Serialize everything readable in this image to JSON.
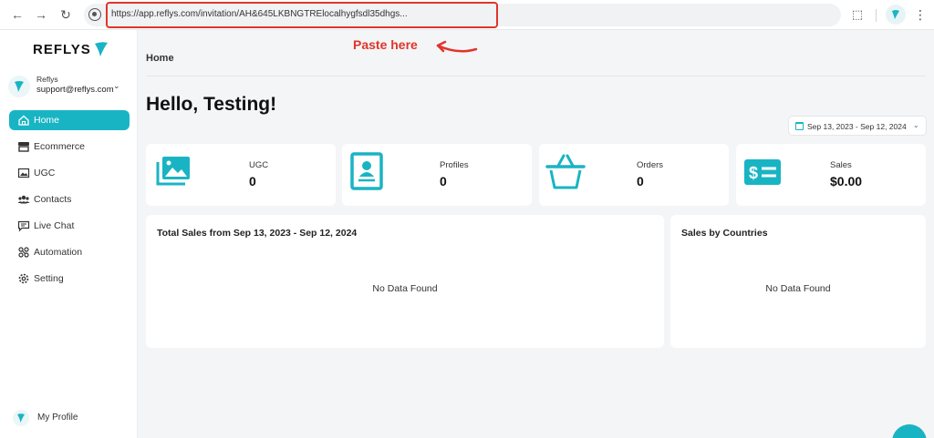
{
  "browser": {
    "back": "←",
    "forward": "→",
    "reload": "↻",
    "url": "https://app.reflys.com/invitation/AH&645LKBNGTRElocalhygfsdl35dhgs...",
    "extensions": "⬚",
    "menu": "⋮"
  },
  "annotation": {
    "text": "Paste here"
  },
  "sidebar": {
    "logo": "REFLYS",
    "account": {
      "name": "Reflys",
      "email": "support@reflys.com",
      "chevron": "⌄"
    },
    "items": [
      {
        "label": "Home",
        "icon": "home-icon"
      },
      {
        "label": "Ecommerce",
        "icon": "store-icon"
      },
      {
        "label": "UGC",
        "icon": "image-icon"
      },
      {
        "label": "Contacts",
        "icon": "users-icon"
      },
      {
        "label": "Live Chat",
        "icon": "chat-icon"
      },
      {
        "label": "Automation",
        "icon": "automation-icon"
      },
      {
        "label": "Setting",
        "icon": "gear-icon"
      }
    ],
    "profile": "My Profile"
  },
  "main": {
    "breadcrumb": "Home",
    "title": "Hello, Testing!",
    "date_range": "Sep 13, 2023 - Sep 12, 2024",
    "date_chevron": "⌄",
    "stats": [
      {
        "label": "UGC",
        "value": "0",
        "icon": "gallery-icon"
      },
      {
        "label": "Profiles",
        "value": "0",
        "icon": "profile-card-icon"
      },
      {
        "label": "Orders",
        "value": "0",
        "icon": "basket-icon"
      },
      {
        "label": "Sales",
        "value": "$0.00",
        "icon": "cash-icon"
      }
    ],
    "panels": [
      {
        "title": "Total Sales from Sep 13, 2023 - Sep 12, 2024",
        "empty": "No Data Found"
      },
      {
        "title": "Sales by Countries",
        "empty": "No Data Found"
      }
    ]
  },
  "colors": {
    "accent": "#19b4c4",
    "annotation": "#e0352b",
    "background": "#f4f5f7"
  }
}
